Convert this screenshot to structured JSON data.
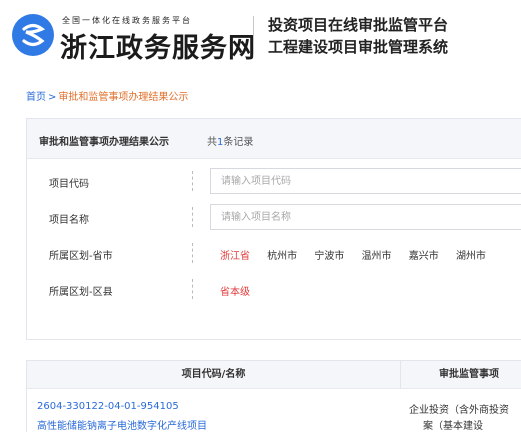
{
  "header": {
    "logo_icon": "zhejiang-gov-logo-icon",
    "brand_sub": "全国一体化在线政务服务平台",
    "brand_main": "浙江政务服务网",
    "system_line1": "投资项目在线审批监管平台",
    "system_line2": "工程建设项目审批管理系统"
  },
  "breadcrumb": {
    "home": "首页",
    "separator": ">",
    "current": "审批和监管事项办理结果公示"
  },
  "filter": {
    "title": "审批和监管事项办理结果公示",
    "count_prefix": "共",
    "count": "1",
    "count_suffix": "条记录",
    "project_code": {
      "label": "项目代码",
      "placeholder": "请输入项目代码",
      "value": ""
    },
    "project_name": {
      "label": "项目名称",
      "placeholder": "请输入项目名称",
      "value": ""
    },
    "region_city": {
      "label": "所属区划-省市",
      "options": [
        "浙江省",
        "杭州市",
        "宁波市",
        "温州市",
        "嘉兴市",
        "湖州市"
      ],
      "selected": "浙江省"
    },
    "region_county": {
      "label": "所属区划-区县",
      "options": [
        "省本级"
      ],
      "selected": "省本级"
    }
  },
  "table": {
    "headers": [
      "项目代码/名称",
      "审批监管事项"
    ],
    "rows": [
      {
        "code": "2604-330122-04-01-954105",
        "name": "高性能储能钠离子电池数字化产线项目",
        "type_line1": "企业投资（含外商投资",
        "type_line2": "案（基本建设"
      }
    ]
  },
  "colors": {
    "accent_blue": "#2a6ad8",
    "logo_blue": "#2f7ae5",
    "breadcrumb_current": "#e0702c",
    "selected_red": "#e23b3b"
  }
}
